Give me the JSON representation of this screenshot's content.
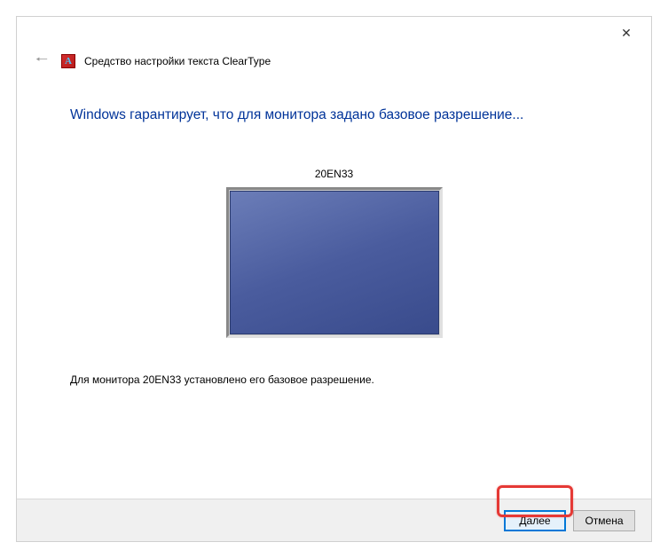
{
  "window": {
    "title": "Средство настройки текста ClearType",
    "icon_letter": "A"
  },
  "content": {
    "heading": "Windows гарантирует, что для монитора задано базовое разрешение...",
    "monitor_name": "20EN33",
    "status_message": "Для монитора 20EN33 установлено его базовое разрешение."
  },
  "footer": {
    "next_label": "Далее",
    "cancel_label": "Отмена"
  }
}
